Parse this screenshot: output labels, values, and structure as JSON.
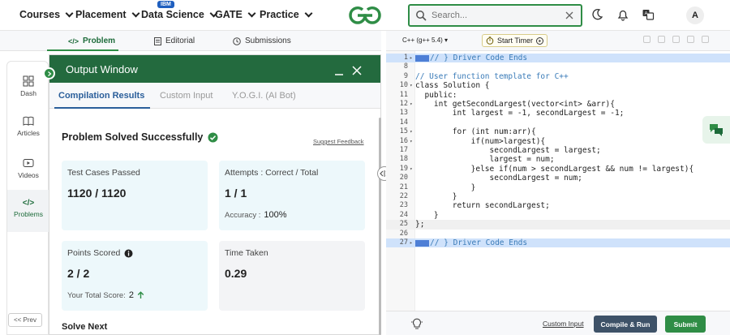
{
  "nav": {
    "items": [
      {
        "label": "Courses"
      },
      {
        "label": "Placement"
      },
      {
        "label": "Data Science",
        "badge": "IBM"
      },
      {
        "label": "GATE"
      },
      {
        "label": "Practice"
      }
    ],
    "search_placeholder": "Search...",
    "avatar": "A"
  },
  "problem_tabs": [
    "Problem",
    "Editorial",
    "Submissions"
  ],
  "sidebar": {
    "items": [
      "Dash",
      "Articles",
      "Videos",
      "Problems"
    ],
    "prev": "<< Prev"
  },
  "output": {
    "title": "Output Window",
    "tabs": [
      "Compilation Results",
      "Custom Input",
      "Y.O.G.I. (AI Bot)"
    ],
    "status": "Problem Solved Successfully",
    "suggest": "Suggest Feedback",
    "cards": {
      "tests_label": "Test Cases Passed",
      "tests_value": "1120 / 1120",
      "attempts_label": "Attempts : Correct / Total",
      "attempts_value": "1 / 1",
      "accuracy_label": "Accuracy :",
      "accuracy_value": "100%",
      "points_label": "Points Scored",
      "points_value": "2 / 2",
      "total_label": "Your Total Score:",
      "total_value": "2",
      "time_label": "Time Taken",
      "time_value": "0.29"
    },
    "solve_next": "Solve Next"
  },
  "editor": {
    "language": "C++ (g++ 5.4)",
    "timer": "Start Timer",
    "custom_input": "Custom Input",
    "compile": "Compile & Run",
    "submit": "Submit",
    "lines": [
      {
        "n": "1",
        "t": "// } Driver Code Ends",
        "hl": true,
        "fold": "▸"
      },
      {
        "n": "8",
        "t": ""
      },
      {
        "n": "9",
        "t": "// User function template for C++"
      },
      {
        "n": "10",
        "t": "class Solution {",
        "fold": "▾"
      },
      {
        "n": "11",
        "t": "  public:"
      },
      {
        "n": "12",
        "t": "    int getSecondLargest(vector<int> &arr){",
        "fold": "▾"
      },
      {
        "n": "13",
        "t": "        int largest = -1, secondLargest = -1;"
      },
      {
        "n": "14",
        "t": ""
      },
      {
        "n": "15",
        "t": "        for (int num:arr){",
        "fold": "▾"
      },
      {
        "n": "16",
        "t": "            if(num>largest){",
        "fold": "▾"
      },
      {
        "n": "17",
        "t": "                secondLargest = largest;"
      },
      {
        "n": "18",
        "t": "                largest = num;"
      },
      {
        "n": "19",
        "t": "            }else if(num > secondLargest && num != largest){",
        "fold": "▾"
      },
      {
        "n": "20",
        "t": "                secondLargest = num;"
      },
      {
        "n": "21",
        "t": "            }"
      },
      {
        "n": "22",
        "t": "        }"
      },
      {
        "n": "23",
        "t": "        return secondLargest;"
      },
      {
        "n": "24",
        "t": "    }"
      },
      {
        "n": "25",
        "t": "};",
        "cur": true
      },
      {
        "n": "26",
        "t": ""
      },
      {
        "n": "27",
        "t": "// } Driver Code Ends",
        "hl": true,
        "fold": "▸"
      }
    ]
  },
  "colors": {
    "brand_green": "#2f8d46",
    "header_green": "#236a3e",
    "link_blue": "#2a5e9a"
  }
}
